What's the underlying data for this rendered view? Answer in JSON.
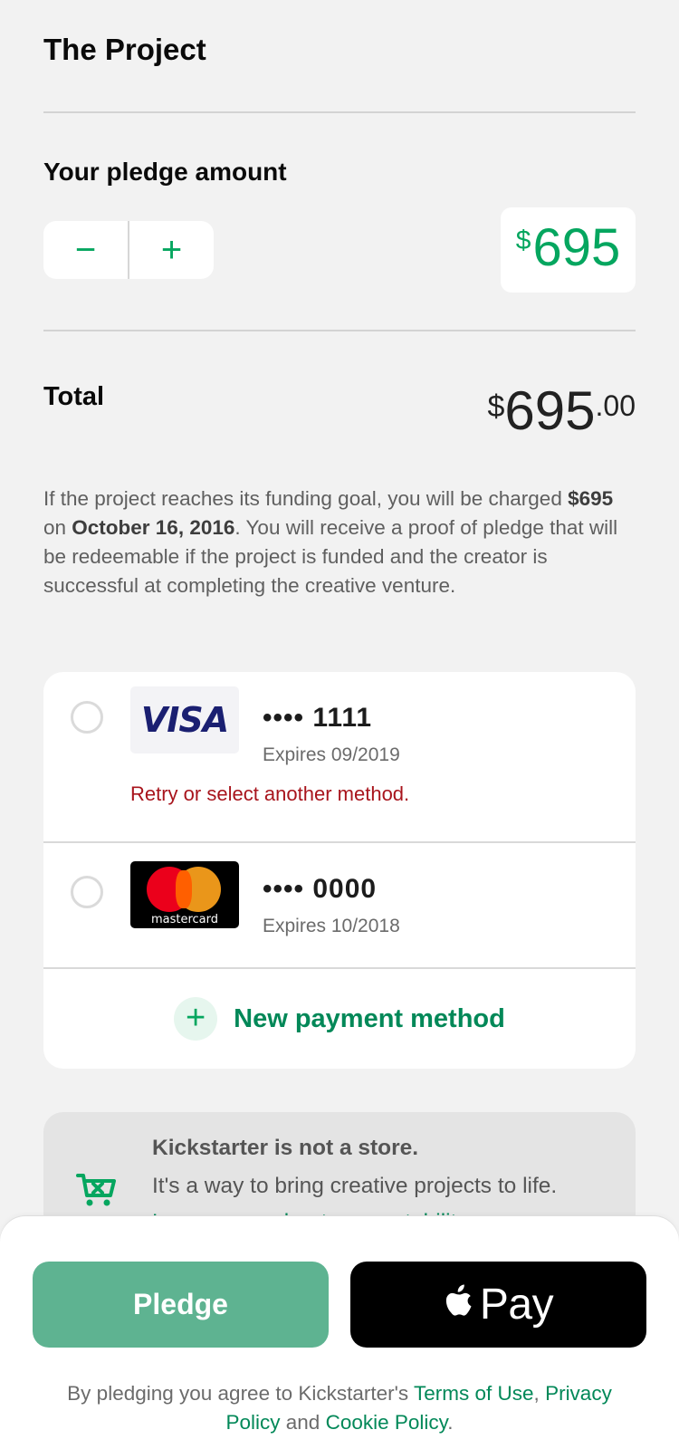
{
  "project": {
    "title": "The Project"
  },
  "pledge": {
    "label": "Your pledge amount",
    "decrement": "−",
    "increment": "+",
    "currency": "$",
    "amount": "695"
  },
  "total": {
    "label": "Total",
    "currency": "$",
    "amount": "695",
    "cents": ".00"
  },
  "info": {
    "part1": "If the project reaches its funding goal, you will be charged ",
    "amount": "$695",
    "part2": " on ",
    "date": "October 16, 2016",
    "part3": ". You will receive a proof of pledge that will be redeemable if the project is funded and the creator is successful at completing the creative venture."
  },
  "payment_methods": {
    "cards": [
      {
        "brand": "VISA",
        "number": "•••• 1111",
        "expiry": "Expires 09/2019",
        "error": "Retry or select another method."
      },
      {
        "brand": "mastercard",
        "number": "•••• 0000",
        "expiry": "Expires 10/2018"
      }
    ],
    "new_method_icon": "+",
    "new_method_label": "New payment method"
  },
  "notice": {
    "icon": "cart-x-icon",
    "title": "Kickstarter is not a store.",
    "body": "It's a way to bring creative projects to life. ",
    "link": "Learn more about accountability"
  },
  "actions": {
    "pledge_label": "Pledge",
    "applepay_label": "Pay"
  },
  "legal": {
    "prefix": "By pledging you agree to Kickstarter's ",
    "terms": "Terms of Use",
    "sep": ", ",
    "privacy": "Privacy Policy",
    "and": " and ",
    "cookie": "Cookie Policy",
    "end": "."
  },
  "colors": {
    "accent": "#05a65f",
    "accent_dark": "#028858",
    "error": "#a8141c",
    "pledge_button": "#5eb391"
  }
}
